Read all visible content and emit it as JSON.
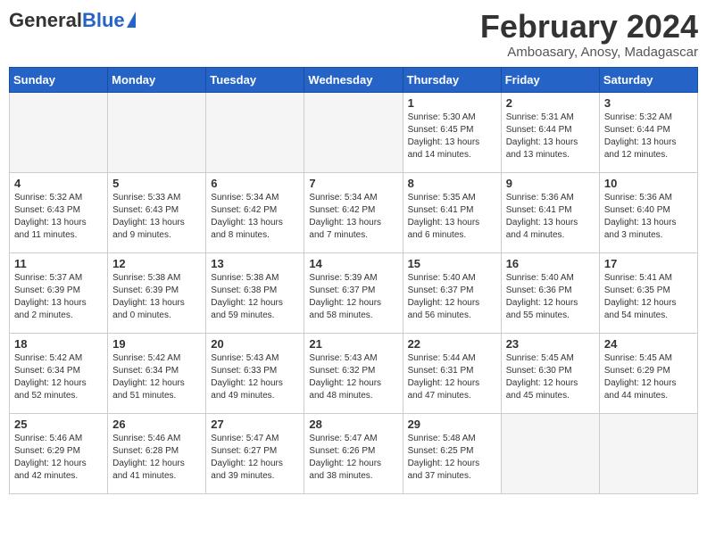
{
  "header": {
    "logo_general": "General",
    "logo_blue": "Blue",
    "title": "February 2024",
    "subtitle": "Amboasary, Anosy, Madagascar"
  },
  "weekdays": [
    "Sunday",
    "Monday",
    "Tuesday",
    "Wednesday",
    "Thursday",
    "Friday",
    "Saturday"
  ],
  "weeks": [
    [
      {
        "day": "",
        "info": ""
      },
      {
        "day": "",
        "info": ""
      },
      {
        "day": "",
        "info": ""
      },
      {
        "day": "",
        "info": ""
      },
      {
        "day": "1",
        "info": "Sunrise: 5:30 AM\nSunset: 6:45 PM\nDaylight: 13 hours\nand 14 minutes."
      },
      {
        "day": "2",
        "info": "Sunrise: 5:31 AM\nSunset: 6:44 PM\nDaylight: 13 hours\nand 13 minutes."
      },
      {
        "day": "3",
        "info": "Sunrise: 5:32 AM\nSunset: 6:44 PM\nDaylight: 13 hours\nand 12 minutes."
      }
    ],
    [
      {
        "day": "4",
        "info": "Sunrise: 5:32 AM\nSunset: 6:43 PM\nDaylight: 13 hours\nand 11 minutes."
      },
      {
        "day": "5",
        "info": "Sunrise: 5:33 AM\nSunset: 6:43 PM\nDaylight: 13 hours\nand 9 minutes."
      },
      {
        "day": "6",
        "info": "Sunrise: 5:34 AM\nSunset: 6:42 PM\nDaylight: 13 hours\nand 8 minutes."
      },
      {
        "day": "7",
        "info": "Sunrise: 5:34 AM\nSunset: 6:42 PM\nDaylight: 13 hours\nand 7 minutes."
      },
      {
        "day": "8",
        "info": "Sunrise: 5:35 AM\nSunset: 6:41 PM\nDaylight: 13 hours\nand 6 minutes."
      },
      {
        "day": "9",
        "info": "Sunrise: 5:36 AM\nSunset: 6:41 PM\nDaylight: 13 hours\nand 4 minutes."
      },
      {
        "day": "10",
        "info": "Sunrise: 5:36 AM\nSunset: 6:40 PM\nDaylight: 13 hours\nand 3 minutes."
      }
    ],
    [
      {
        "day": "11",
        "info": "Sunrise: 5:37 AM\nSunset: 6:39 PM\nDaylight: 13 hours\nand 2 minutes."
      },
      {
        "day": "12",
        "info": "Sunrise: 5:38 AM\nSunset: 6:39 PM\nDaylight: 13 hours\nand 0 minutes."
      },
      {
        "day": "13",
        "info": "Sunrise: 5:38 AM\nSunset: 6:38 PM\nDaylight: 12 hours\nand 59 minutes."
      },
      {
        "day": "14",
        "info": "Sunrise: 5:39 AM\nSunset: 6:37 PM\nDaylight: 12 hours\nand 58 minutes."
      },
      {
        "day": "15",
        "info": "Sunrise: 5:40 AM\nSunset: 6:37 PM\nDaylight: 12 hours\nand 56 minutes."
      },
      {
        "day": "16",
        "info": "Sunrise: 5:40 AM\nSunset: 6:36 PM\nDaylight: 12 hours\nand 55 minutes."
      },
      {
        "day": "17",
        "info": "Sunrise: 5:41 AM\nSunset: 6:35 PM\nDaylight: 12 hours\nand 54 minutes."
      }
    ],
    [
      {
        "day": "18",
        "info": "Sunrise: 5:42 AM\nSunset: 6:34 PM\nDaylight: 12 hours\nand 52 minutes."
      },
      {
        "day": "19",
        "info": "Sunrise: 5:42 AM\nSunset: 6:34 PM\nDaylight: 12 hours\nand 51 minutes."
      },
      {
        "day": "20",
        "info": "Sunrise: 5:43 AM\nSunset: 6:33 PM\nDaylight: 12 hours\nand 49 minutes."
      },
      {
        "day": "21",
        "info": "Sunrise: 5:43 AM\nSunset: 6:32 PM\nDaylight: 12 hours\nand 48 minutes."
      },
      {
        "day": "22",
        "info": "Sunrise: 5:44 AM\nSunset: 6:31 PM\nDaylight: 12 hours\nand 47 minutes."
      },
      {
        "day": "23",
        "info": "Sunrise: 5:45 AM\nSunset: 6:30 PM\nDaylight: 12 hours\nand 45 minutes."
      },
      {
        "day": "24",
        "info": "Sunrise: 5:45 AM\nSunset: 6:29 PM\nDaylight: 12 hours\nand 44 minutes."
      }
    ],
    [
      {
        "day": "25",
        "info": "Sunrise: 5:46 AM\nSunset: 6:29 PM\nDaylight: 12 hours\nand 42 minutes."
      },
      {
        "day": "26",
        "info": "Sunrise: 5:46 AM\nSunset: 6:28 PM\nDaylight: 12 hours\nand 41 minutes."
      },
      {
        "day": "27",
        "info": "Sunrise: 5:47 AM\nSunset: 6:27 PM\nDaylight: 12 hours\nand 39 minutes."
      },
      {
        "day": "28",
        "info": "Sunrise: 5:47 AM\nSunset: 6:26 PM\nDaylight: 12 hours\nand 38 minutes."
      },
      {
        "day": "29",
        "info": "Sunrise: 5:48 AM\nSunset: 6:25 PM\nDaylight: 12 hours\nand 37 minutes."
      },
      {
        "day": "",
        "info": ""
      },
      {
        "day": "",
        "info": ""
      }
    ]
  ]
}
